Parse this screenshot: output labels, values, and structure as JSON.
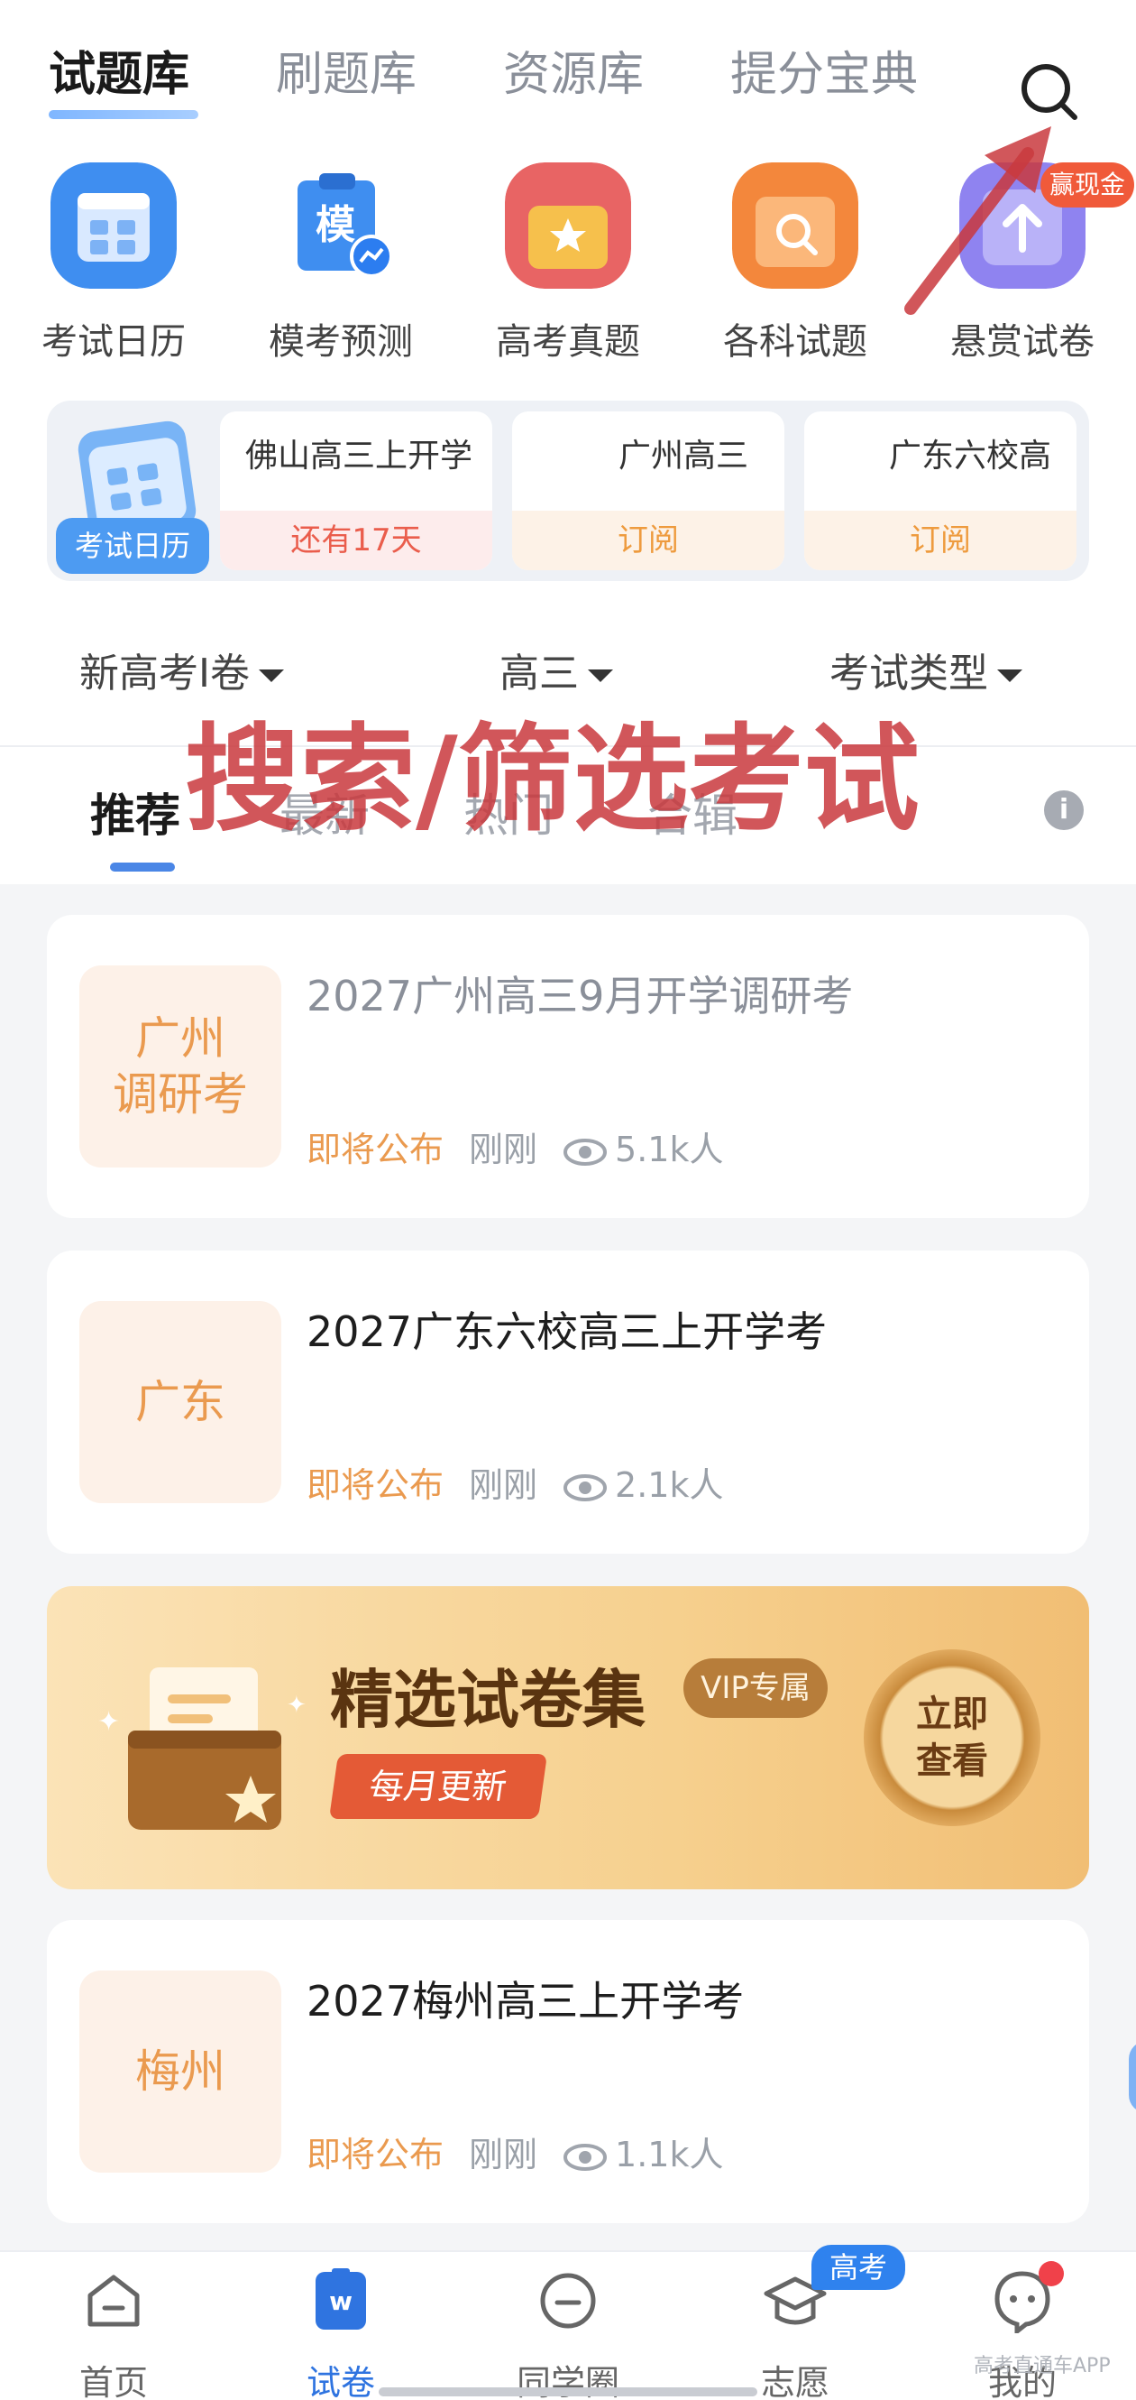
{
  "top_tabs": [
    "试题库",
    "刷题库",
    "资源库",
    "提分宝典"
  ],
  "features": [
    {
      "label": "考试日历",
      "icon": "calendar-icon"
    },
    {
      "label": "模考预测",
      "icon": "mock-exam-icon",
      "icon_text": "模"
    },
    {
      "label": "高考真题",
      "icon": "star-folder-icon"
    },
    {
      "label": "各科试题",
      "icon": "search-folder-icon"
    },
    {
      "label": "悬赏试卷",
      "icon": "upload-arrow-icon"
    }
  ],
  "cash_badge": "赢现金",
  "calendar": {
    "tag": "考试日历",
    "items": [
      {
        "title": "佛山高三上开学",
        "status": "还有17天"
      },
      {
        "title": "广州高三",
        "status": "订阅"
      },
      {
        "title": "广东六校高",
        "status": "订阅"
      }
    ]
  },
  "filters": [
    "新高考Ⅰ卷",
    "高三",
    "考试类型"
  ],
  "sub_tabs": [
    "推荐",
    "最新",
    "热门",
    "合辑"
  ],
  "info_icon": "i",
  "overlay": "搜索/筛选考试",
  "exams": [
    {
      "thumb": "广州\n调研考",
      "title": "2027广州高三9月开学调研考",
      "status": "即将公布",
      "time": "刚刚",
      "views": "5.1k人"
    },
    {
      "thumb": "广东",
      "title": "2027广东六校高三上开学考",
      "status": "即将公布",
      "time": "刚刚",
      "views": "2.1k人"
    },
    {
      "thumb": "梅州",
      "title": "2027梅州高三上开学考",
      "status": "即将公布",
      "time": "刚刚",
      "views": "1.1k人"
    }
  ],
  "banner": {
    "title": "精选试卷集",
    "vip": "VIP专属",
    "monthly": "每月更新",
    "button": "立即\n查看"
  },
  "bottom_nav": [
    "首页",
    "试卷",
    "同学圈",
    "志愿",
    "我的"
  ],
  "gaokao_badge": "高考",
  "watermark": "高考直通车APP",
  "colors": {
    "accent": "#2f74e0",
    "orange": "#ea9a4f",
    "annotation": "#c9393e"
  }
}
